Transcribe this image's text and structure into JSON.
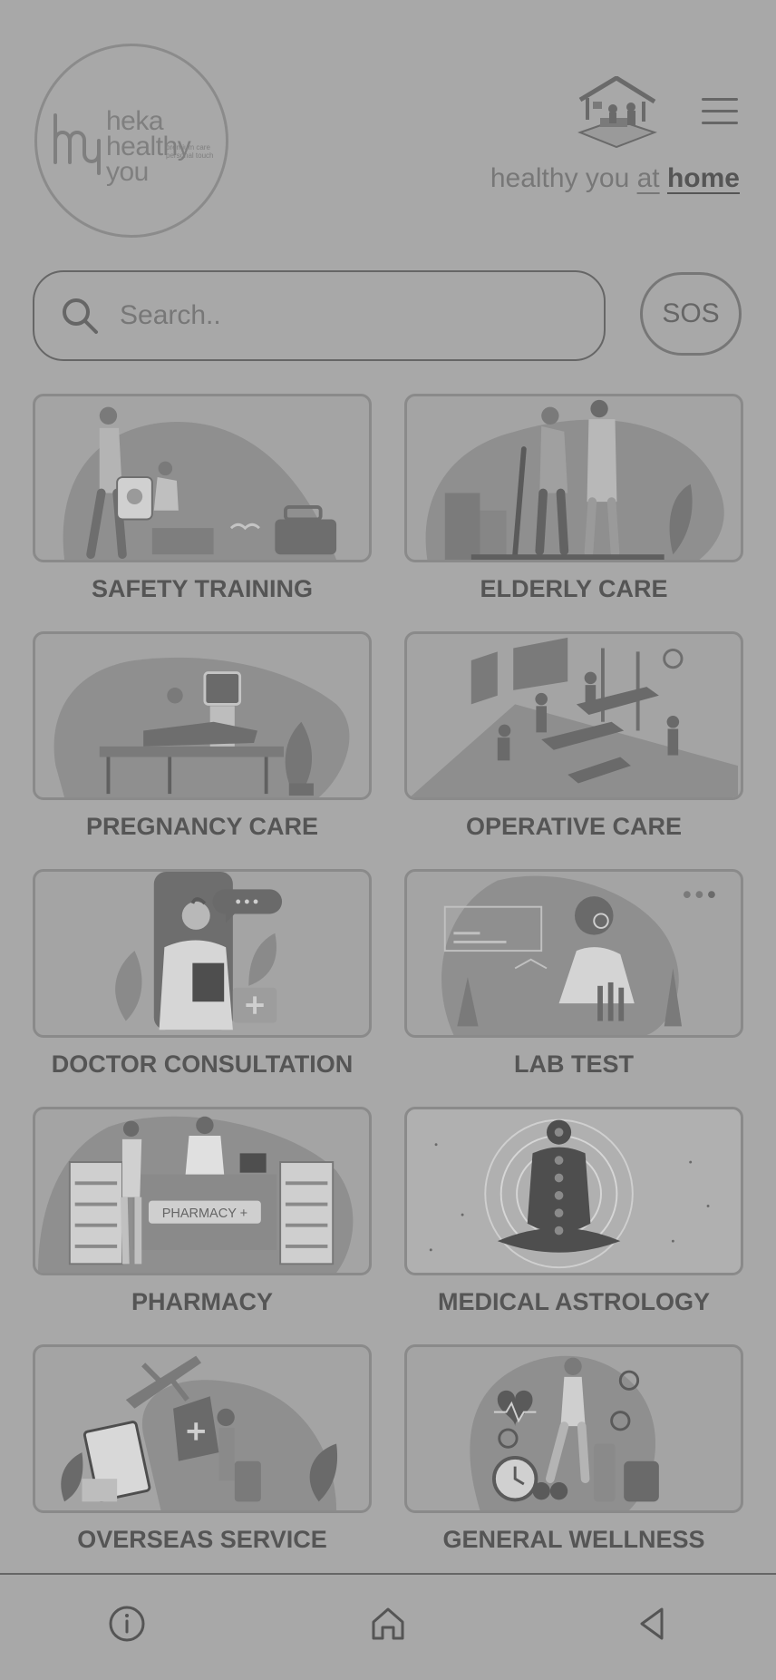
{
  "brand": {
    "line1": "heka",
    "line2": "healthy",
    "line3": "you",
    "tagline1": "premium care",
    "tagline2": "personal touch"
  },
  "header": {
    "tagline_prefix": "healthy you ",
    "tagline_at": "at",
    "tagline_space": " ",
    "tagline_home": "home"
  },
  "search": {
    "placeholder": "Search..",
    "value": ""
  },
  "sos": {
    "label": "SOS"
  },
  "services": [
    {
      "label": "SAFETY TRAINING"
    },
    {
      "label": "ELDERLY CARE"
    },
    {
      "label": "PREGNANCY CARE"
    },
    {
      "label": "OPERATIVE CARE"
    },
    {
      "label": "DOCTOR CONSULTATION"
    },
    {
      "label": "LAB TEST"
    },
    {
      "label": "PHARMACY"
    },
    {
      "label": "MEDICAL ASTROLOGY"
    },
    {
      "label": "OVERSEAS SERVICE"
    },
    {
      "label": "GENERAL WELLNESS"
    }
  ],
  "pharmacy_sign": "PHARMACY +",
  "bottom_nav": [
    {
      "icon": "info-icon"
    },
    {
      "icon": "home-icon"
    },
    {
      "icon": "back-icon"
    }
  ]
}
